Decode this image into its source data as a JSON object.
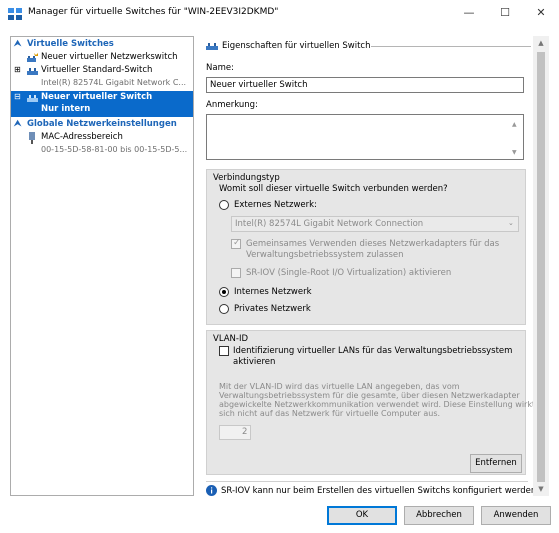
{
  "window": {
    "title": "Manager für virtuelle Switches für \"WIN-2EEV3I2DKMD\"",
    "minimize": "—",
    "maximize": "☐",
    "close": "✕"
  },
  "tree": {
    "virtual_switches_header": "Virtuelle Switches",
    "new_network_switch": "Neuer virtueller Netzwerkswitch",
    "standard_switch": "Virtueller Standard-Switch",
    "standard_switch_sub": "Intel(R) 82574L Gigabit Network C...",
    "new_switch": "Neuer virtueller Switch",
    "new_switch_sub": "Nur intern",
    "global_header": "Globale Netzwerkeinstellungen",
    "mac_range": "MAC-Adressbereich",
    "mac_range_sub": "00-15-5D-58-81-00 bis 00-15-5D-5..."
  },
  "props": {
    "section_title": "Eigenschaften für virtuellen Switch",
    "name_label": "Name:",
    "name_value": "Neuer virtueller Switch",
    "note_label": "Anmerkung:",
    "note_value": "",
    "conn_type": "Verbindungstyp",
    "conn_question": "Womit soll dieser virtuelle Switch verbunden werden?",
    "external": "Externes Netzwerk:",
    "adapter": "Intel(R) 82574L Gigabit Network Connection",
    "share_line1": "Gemeinsames Verwenden dieses Netzwerkadapters für das",
    "share_line2": "Verwaltungsbetriebssystem zulassen",
    "sriov": "SR-IOV (Single-Root I/O Virtualization) aktivieren",
    "internal": "Internes Netzwerk",
    "private": "Privates Netzwerk",
    "vlan_title": "VLAN-ID",
    "vlan_check_line1": "Identifizierung virtueller LANs für das Verwaltungsbetriebssystem",
    "vlan_check_line2": "aktivieren",
    "vlan_desc": [
      "Mit der VLAN-ID wird das virtuelle LAN angegeben, das vom",
      "Verwaltungsbetriebssystem für die gesamte, über diesen Netzwerkadapter",
      "abgewickelte Netzwerkkommunikation verwendet wird. Diese Einstellung wirkt",
      "sich nicht auf das Netzwerk für virtuelle Computer aus."
    ],
    "vlan_value": "2",
    "remove": "Entfernen",
    "info": "SR-IOV kann nur beim Erstellen des virtuellen Switchs konfiguriert werden. Ein"
  },
  "connection": {
    "selected": "internal"
  },
  "buttons": {
    "ok": "OK",
    "cancel": "Abbrechen",
    "apply": "Anwenden"
  },
  "colors": {
    "selection": "#0a6acb",
    "header_blue": "#1e66b8",
    "group_bg": "#e6e6e6",
    "info_blue": "#1a5fb4"
  }
}
